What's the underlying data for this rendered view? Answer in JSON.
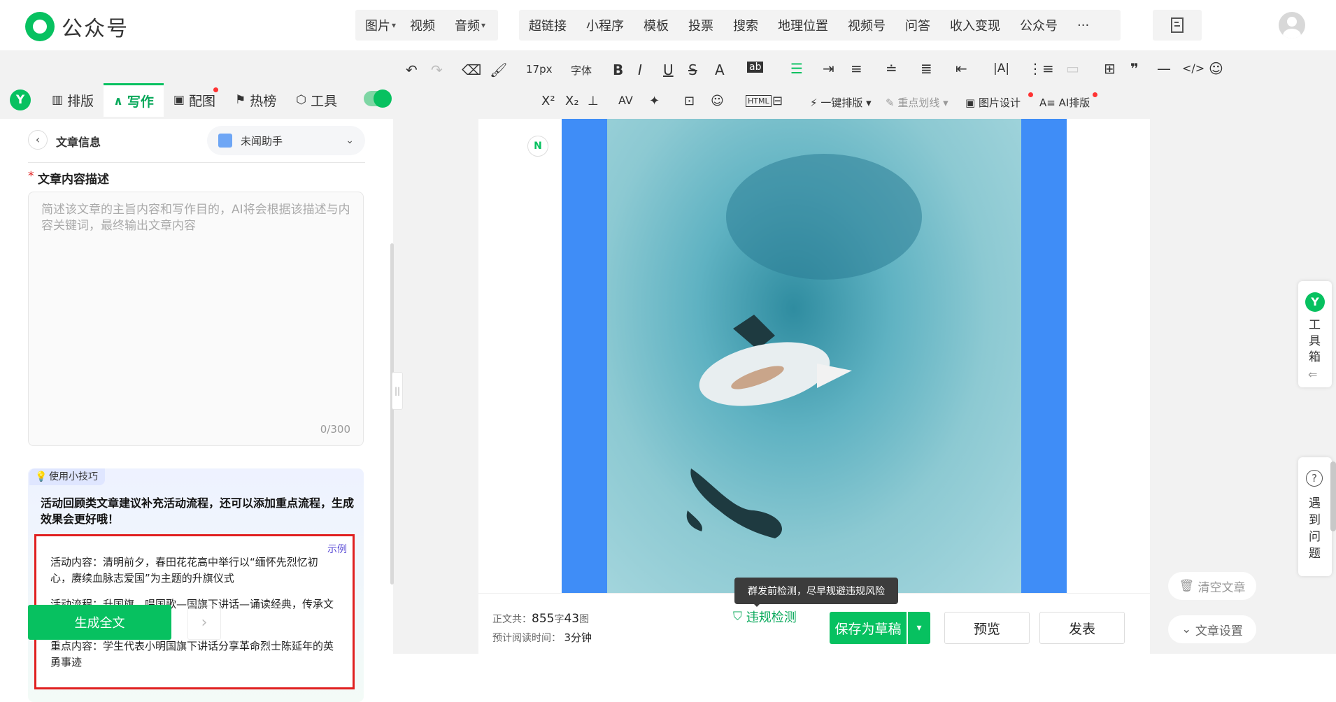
{
  "app": {
    "title": "公众号"
  },
  "top_nav": {
    "media": [
      {
        "label": "图片",
        "arrow": "·"
      },
      {
        "label": "视频",
        "arrow": ""
      },
      {
        "label": "音频",
        "arrow": "·"
      }
    ],
    "tools": [
      {
        "label": "超链接",
        "dot": false
      },
      {
        "label": "小程序",
        "dot": false
      },
      {
        "label": "模板",
        "dot": false
      },
      {
        "label": "投票",
        "dot": false
      },
      {
        "label": "搜索",
        "dot": false
      },
      {
        "label": "地理位置",
        "dot": false
      },
      {
        "label": "视频号",
        "dot": false
      },
      {
        "label": "问答",
        "dot": false
      },
      {
        "label": "收入变现",
        "dot": true
      },
      {
        "label": "公众号",
        "dot": true
      },
      {
        "label": "···",
        "dot": false
      }
    ]
  },
  "toolbar": {
    "font_size": "17px",
    "font_family": "字体",
    "one_click": "一键排版",
    "highlight": "重点划线",
    "image_design": "图片设计",
    "ai_layout": "AI排版"
  },
  "left_tabs": [
    {
      "label": "排版",
      "active": false,
      "dot": false
    },
    {
      "label": "写作",
      "active": true,
      "dot": false
    },
    {
      "label": "配图",
      "active": false,
      "dot": true
    },
    {
      "label": "热榜",
      "active": false,
      "dot": false
    },
    {
      "label": "工具",
      "active": false,
      "dot": false
    }
  ],
  "panel": {
    "back_title": "文章信息",
    "assistant": "未闻助手",
    "field_label": "文章内容描述",
    "required_mark": "*",
    "placeholder": "简述该文章的主旨内容和写作目的，AI将会根据该描述与内容关键词，最终输出文章内容",
    "counter": "0/300",
    "tip_tag": "使用小技巧",
    "tip_text": "活动回顾类文章建议补充活动流程，还可以添加重点流程，生成效果会更好哦！",
    "example_tag": "示例",
    "examples": [
      "活动内容：清明前夕，春田花花高中举行以“缅怀先烈忆初心，赓续血脉志爱国”为主题的升旗仪式",
      "活动流程：升国旗，唱国歌—国旗下讲话—诵读经典，传承文化《贺新郎•国脉微如缕》",
      "重点内容：学生代表小明国旗下讲话分享革命烈士陈延年的英勇事迹"
    ],
    "generate": "生成全文"
  },
  "bottom": {
    "word_label": "正文共：",
    "word_count": "855",
    "word_unit": "字",
    "image_count": "43",
    "image_unit": "图",
    "read_label": "预计阅读时间：",
    "read_time": "3",
    "read_unit": "分钟",
    "tooltip": "群发前检测，尽早规避违规风险",
    "check": "违规检测",
    "save": "保存为草稿",
    "preview": "预览",
    "publish": "发表"
  },
  "side": {
    "toolbox": "工具箱",
    "problem": "遇到问题",
    "clear": "清空文章",
    "settings": "文章设置"
  },
  "colors": {
    "brand": "#07c160",
    "blue": "#3f8df7",
    "red": "#e02020",
    "dot": "#ff3333"
  }
}
